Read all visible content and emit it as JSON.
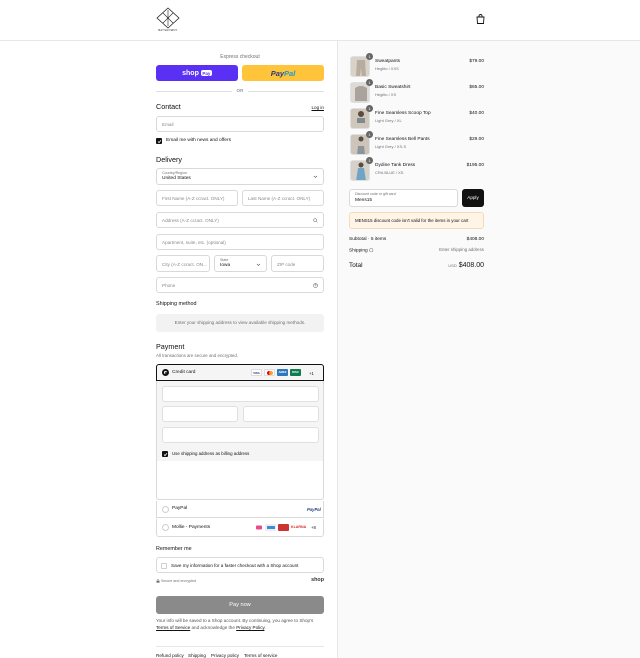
{
  "header": {
    "logo_text": "BAYSHOWNY",
    "bag_icon": "shopping-bag-icon"
  },
  "express": {
    "label": "Express checkout",
    "shop_label": "shop",
    "shop_pay_tag": "Pay",
    "paypal_part1": "Pay",
    "paypal_part2": "Pal",
    "or_label": "OR"
  },
  "contact": {
    "heading": "Contact",
    "login": "Log in",
    "email_placeholder": "Email",
    "news_checkbox_label": "Email me with news and offers"
  },
  "delivery": {
    "heading": "Delivery",
    "country_label": "Country/Region",
    "country_value": "United States",
    "first_name_placeholder": "First Name (A-Z ccract. ONLY)",
    "last_name_placeholder": "Last Name (A-Z ccract. ONLY)",
    "address_placeholder": "Address (A-Z ccract. ONLY)",
    "apartment_placeholder": "Apartment, suite, etc. (optional)",
    "city_placeholder": "City (A-Z ccract. ON...",
    "state_label": "State",
    "state_value": "Iowa",
    "zip_placeholder": "ZIP code",
    "phone_placeholder": "Phone"
  },
  "shipping_method": {
    "heading": "Shipping method",
    "message": "Enter your shipping address to view available shipping methods."
  },
  "payment": {
    "heading": "Payment",
    "subtitle": "All transactions are secure and encrypted.",
    "credit_card_label": "Credit card",
    "card_brands": [
      "VISA",
      "MC",
      "AMEX",
      "DISC"
    ],
    "more_cards": "+1",
    "billing_checkbox_label": "Use shipping address as billing address",
    "paypal_label": "PayPal",
    "paypal_logo": "PayPal",
    "mollie_label": "Mollie - Payments",
    "mollie_more": "+8",
    "mollie_brand_text": "KLARNA"
  },
  "remember": {
    "heading": "Remember me",
    "checkbox_label": "Save my information for a faster checkout with a Shop account",
    "secure_label": "Secure and encrypted",
    "shop_logo": "shop"
  },
  "pay_now": {
    "label": "Pay now"
  },
  "legal": {
    "text1": "Your info will be saved to a Shop account. By continuing, you agree to Shop's",
    "tos": "Terms of Service",
    "text2": " and acknowledge the ",
    "privacy": "Privacy Policy",
    "text3": "."
  },
  "footer": {
    "links": [
      "Refund policy",
      "Shipping",
      "Privacy policy",
      "Terms of service"
    ]
  },
  "cart": {
    "items": [
      {
        "qty": "1",
        "name": "Sweatpants",
        "variant": "Heglito / XXS",
        "price": "$79.00"
      },
      {
        "qty": "1",
        "name": "Basic Sweatshirt",
        "variant": "Heglito / XS",
        "price": "$65.00"
      },
      {
        "qty": "1",
        "name": "Fine Seamless Scoop Top",
        "variant": "Light Grey / XL",
        "price": "$40.00"
      },
      {
        "qty": "1",
        "name": "Fine Seamless Bell Pants",
        "variant": "Light Grey / XS-S",
        "price": "$29.00"
      },
      {
        "qty": "1",
        "name": "Dydine Tank Dress",
        "variant": "CRA BLUE / XS",
        "price": "$195.00"
      }
    ],
    "discount_label": "Discount code or gift card",
    "discount_value": "Mens15",
    "apply_label": "Apply",
    "notice": "MENS15 discount code isn't valid for the items in your cart",
    "subtotal_label": "Subtotal · 5 items",
    "subtotal_value": "$408.00",
    "shipping_label": "Shipping",
    "shipping_value": "Enter shipping address",
    "total_label": "Total",
    "total_currency": "USD",
    "total_value": "$408.00"
  }
}
